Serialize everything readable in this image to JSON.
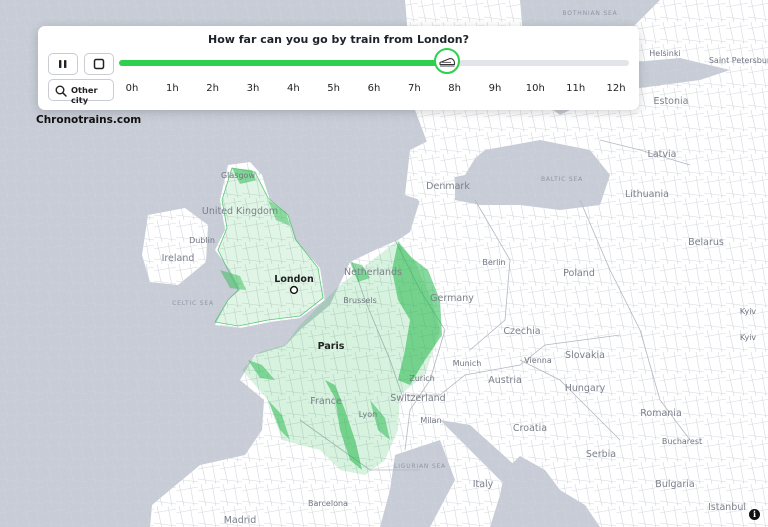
{
  "controls": {
    "title": "How far can you go by train from London?",
    "pause_icon": "pause-icon",
    "stop_icon": "stop-icon",
    "other_city_label": "Other city",
    "search_icon": "search-icon",
    "train_icon": "train-icon",
    "hours": [
      "0h",
      "1h",
      "2h",
      "3h",
      "4h",
      "5h",
      "6h",
      "7h",
      "8h",
      "9h",
      "10h",
      "11h",
      "12h"
    ],
    "progress_hours": 7.8,
    "max_hours": 12,
    "accent_color": "#2dd14e"
  },
  "brand": "Chronotrains.com",
  "info_icon": "info-icon",
  "map": {
    "origin_city": "London",
    "major_cities": [
      "London",
      "Paris"
    ],
    "countries": [
      "United Kingdom",
      "Ireland",
      "Denmark",
      "Netherlands",
      "Germany",
      "Poland",
      "Czechia",
      "Slovakia",
      "Austria",
      "Switzerland",
      "France",
      "Hungary",
      "Croatia",
      "Serbia",
      "Romania",
      "Bulgaria",
      "Italy",
      "Lithuania",
      "Latvia",
      "Estonia",
      "Belarus"
    ],
    "cities": [
      "Glasgow",
      "Dublin",
      "Brussels",
      "Berlin",
      "Munich",
      "Vienna",
      "Zurich",
      "Lyon",
      "Milan",
      "Barcelona",
      "Madrid",
      "Bucharest",
      "Istanbul",
      "Helsinki",
      "Saint Petersburg",
      "Kyiv",
      "Kyiv"
    ],
    "seas": [
      "BOTHNIAN SEA",
      "BALTIC SEA",
      "CELTIC SEA",
      "LIGURIAN SEA"
    ],
    "reach_color": "#22b84a"
  }
}
